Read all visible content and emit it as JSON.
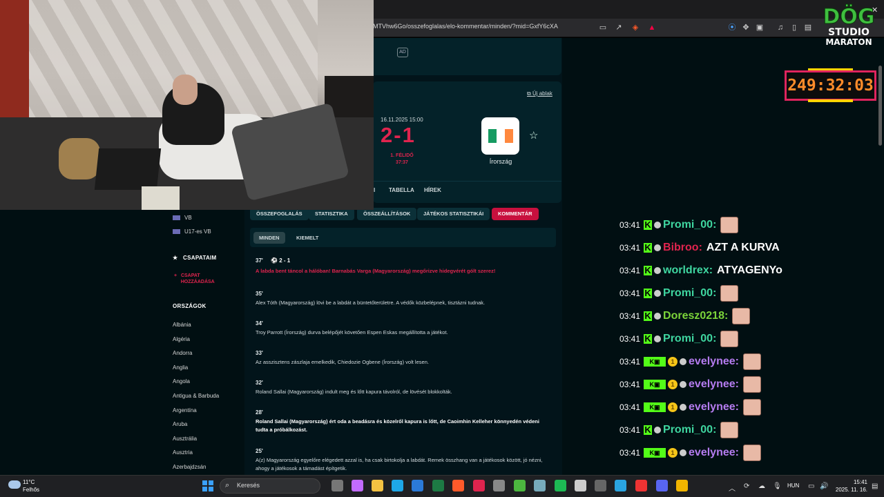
{
  "browser": {
    "url": "MTVhw6Go/osszefoglalas/elo-kommentar/minden/?mid=GxfY6cXA"
  },
  "ad_label": "AD",
  "match": {
    "new_window": "Új ablak",
    "date": "16.11.2025 15:00",
    "score": "2-1",
    "period": "1. FÉLIDŐ",
    "clock": "37:37",
    "team_away": "Írország",
    "flag_colors": [
      "#169b62",
      "#ffffff",
      "#ff883e"
    ]
  },
  "nav_tabs": [
    "I",
    "TABELLA",
    "HÍREK"
  ],
  "pills": [
    "ÖSSZEFOGLALÁS",
    "STATISZTIKA",
    "ÖSSZEÁLLÍTÁSOK",
    "JÁTÉKOS STATISZTIKÁI",
    "KOMMENTÁR"
  ],
  "subtabs": [
    "MINDEN",
    "KIEMELT"
  ],
  "sidebar": {
    "competitions": [
      "VB",
      "U17-es VB"
    ],
    "my_teams": "CSAPATAIM",
    "add_team_line1": "CSAPAT",
    "add_team_line2": "HOZZÁADÁSA",
    "countries_head": "ORSZÁGOK",
    "countries": [
      "Albánia",
      "Algéria",
      "Andorra",
      "Anglia",
      "Angola",
      "Antigua & Barbuda",
      "Argentína",
      "Aruba",
      "Ausztrália",
      "Ausztria",
      "Azerbajdzsán"
    ]
  },
  "events": [
    {
      "time": "37'",
      "score": "2 - 1",
      "text": "A labda bent táncol a hálóban! Barnabás Varga (Magyarország) megőrizve hidegvérét gólt szerez!",
      "style": "red"
    },
    {
      "time": "35'",
      "text": "Alex Tóth (Magyarország) lövi be a labdát a büntetőterületre. A védők közbelépnek, tisztázni tudnak.",
      "style": "normal"
    },
    {
      "time": "34'",
      "text": "Troy Parrott (Írország) durva belépőjét követően Espen Eskas megállította a játékot.",
      "style": "normal"
    },
    {
      "time": "33'",
      "text": "Az asszisztens zászlaja emelkedik, Chiedozie Ogbene (Írország) volt lesen.",
      "style": "normal"
    },
    {
      "time": "32'",
      "text": "Roland Sallai (Magyarország) indult meg és lőtt kapura távolról, de lövését blokkolták.",
      "style": "normal"
    },
    {
      "time": "28'",
      "text": "Roland Sallai (Magyarország) ért oda a beadásra és közelről kapura is lőtt, de Caoimhin Kelleher könnyedén védeni tudta a próbálkozást.",
      "style": "bold"
    },
    {
      "time": "25'",
      "text": "A(z) Magyarország egyelőre elégedett azzal is, ha csak birtokolja a labdát. Remek összhang van a játékosok között, jó nézni, ahogy a játékosok a támadást építgetik.",
      "style": "normal"
    }
  ],
  "overlay": {
    "logo_main": "DÖG",
    "logo_sub1": "STUDIO",
    "logo_sub2": "MARATON",
    "timer": "249:32:03"
  },
  "chat": [
    {
      "time": "03:41",
      "badge": "K",
      "user": "Promi_00:",
      "user_color": "#3fd6a0",
      "msg": "",
      "emote": true
    },
    {
      "time": "03:41",
      "badge": "K",
      "user": "Bibroo:",
      "user_color": "#e0244e",
      "msg": "AZT A KURVA",
      "emote": false
    },
    {
      "time": "03:41",
      "badge": "K",
      "user": "worldrex:",
      "user_color": "#3fd6a0",
      "msg": "ATYAGENYo",
      "emote": false
    },
    {
      "time": "03:41",
      "badge": "K",
      "user": "Promi_00:",
      "user_color": "#3fd6a0",
      "msg": "",
      "emote": true
    },
    {
      "time": "03:41",
      "badge": "K",
      "user": "Doresz0218:",
      "user_color": "#7cd43a",
      "msg": "",
      "emote": true
    },
    {
      "time": "03:41",
      "badge": "K",
      "user": "Promi_00:",
      "user_color": "#3fd6a0",
      "msg": "",
      "emote": true
    },
    {
      "time": "03:41",
      "badge": "KIS",
      "user": "evelynee:",
      "user_color": "#b57cf0",
      "msg": "",
      "emote": true
    },
    {
      "time": "03:41",
      "badge": "KIS",
      "user": "evelynee:",
      "user_color": "#b57cf0",
      "msg": "",
      "emote": true
    },
    {
      "time": "03:41",
      "badge": "KIS",
      "user": "evelynee:",
      "user_color": "#b57cf0",
      "msg": "",
      "emote": true
    },
    {
      "time": "03:41",
      "badge": "K",
      "user": "Promi_00:",
      "user_color": "#3fd6a0",
      "msg": "",
      "emote": true
    },
    {
      "time": "03:41",
      "badge": "KIS",
      "user": "evelynee:",
      "user_color": "#b57cf0",
      "msg": "",
      "emote": true
    }
  ],
  "taskbar": {
    "temp": "11°C",
    "weather": "Felhős",
    "search": "Keresés",
    "lang": "HUN",
    "time": "15:41",
    "date": "2025. 11. 16."
  }
}
